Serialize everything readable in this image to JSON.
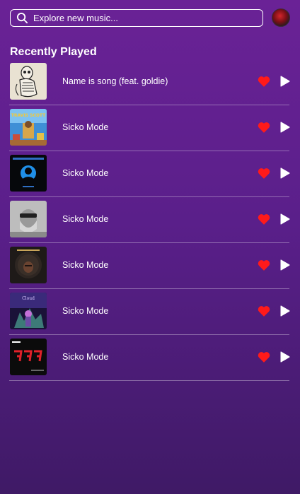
{
  "search": {
    "placeholder": "Explore new music...",
    "value": ""
  },
  "section": {
    "title": "Recently Played"
  },
  "colors": {
    "heart": "#ff1a1a",
    "play": "#ffffff",
    "accent": "#6a2296"
  },
  "icons": {
    "search": "search-icon",
    "like": "heart-icon",
    "play": "play-icon",
    "avatar": "user-avatar"
  },
  "tracks": [
    {
      "title": "Name is song (feat. goldie)",
      "cover": "skeleton-cover"
    },
    {
      "title": "Sicko Mode",
      "cover": "astroworld-cover"
    },
    {
      "title": "Sicko Mode",
      "cover": "blue-silhouette-cover"
    },
    {
      "title": "Sicko Mode",
      "cover": "gray-portrait-cover"
    },
    {
      "title": "Sicko Mode",
      "cover": "afro-portrait-cover"
    },
    {
      "title": "Sicko Mode",
      "cover": "purple-fantasy-cover"
    },
    {
      "title": "Sicko Mode",
      "cover": "red-digits-cover"
    }
  ]
}
